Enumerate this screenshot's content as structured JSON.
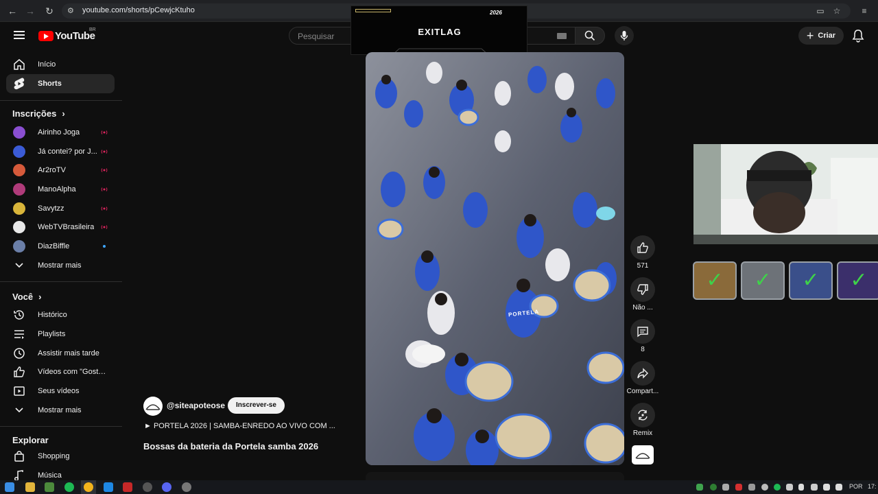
{
  "browser": {
    "url": "youtube.com/shorts/pCewjcKtuho",
    "icons": [
      "back-arrow-icon",
      "forward-arrow-icon",
      "reload-icon",
      "site-info-icon",
      "cast-icon",
      "bookmark-star-icon",
      "reading-list-icon"
    ]
  },
  "header": {
    "logo_text": "YouTube",
    "country_code": "BR",
    "search_placeholder": "Pesquisar",
    "create_label": "Criar"
  },
  "ad_overlay": {
    "brand": "EXITLAG",
    "tag": "2026"
  },
  "sidebar": {
    "main": [
      {
        "label": "Início",
        "icon": "home-icon"
      },
      {
        "label": "Shorts",
        "icon": "shorts-icon",
        "active": true
      }
    ],
    "subscriptions_heading": "Inscrições",
    "subscriptions": [
      {
        "label": "Airinho Joga",
        "live": true,
        "color": "#8a4fd1"
      },
      {
        "label": "Já contei? por J...",
        "live": true,
        "color": "#3b5bd6"
      },
      {
        "label": "Ar2roTV",
        "live": true,
        "color": "#d65a3b"
      },
      {
        "label": "ManoAlpha",
        "live": true,
        "color": "#b03b7a"
      },
      {
        "label": "Savytzz",
        "live": true,
        "color": "#d9b53a"
      },
      {
        "label": "WebTVBrasileira",
        "live": true,
        "color": "#e8e8e8"
      },
      {
        "label": "DiazBiffle",
        "live": false,
        "dot": true,
        "color": "#6b7fa8"
      }
    ],
    "show_more_1": "Mostrar mais",
    "you_heading": "Você",
    "you_items": [
      {
        "label": "Histórico",
        "icon": "history-icon"
      },
      {
        "label": "Playlists",
        "icon": "playlists-icon"
      },
      {
        "label": "Assistir mais tarde",
        "icon": "watch-later-icon"
      },
      {
        "label": "Vídeos com \"Gostei\"",
        "icon": "liked-videos-icon"
      },
      {
        "label": "Seus vídeos",
        "icon": "your-videos-icon"
      }
    ],
    "show_more_2": "Mostrar mais",
    "explore_heading": "Explorar",
    "explore_items": [
      {
        "label": "Shopping",
        "icon": "shopping-bag-icon"
      },
      {
        "label": "Música",
        "icon": "music-note-icon"
      }
    ]
  },
  "short": {
    "channel_handle": "@siteapoteose",
    "subscribe_label": "Inscrever-se",
    "playlist_line": "► PORTELA 2026 | SAMBA-ENREDO AO VIVO COM ...",
    "title": "Bossas da bateria da Portela samba 2026",
    "jersey_text": "PORTELA"
  },
  "actions": {
    "like_count": "571",
    "dislike_label": "Não ...",
    "comment_count": "8",
    "share_label": "Compart...",
    "remix_label": "Remix"
  },
  "taskbar": {
    "language": "POR",
    "time": "17:"
  }
}
